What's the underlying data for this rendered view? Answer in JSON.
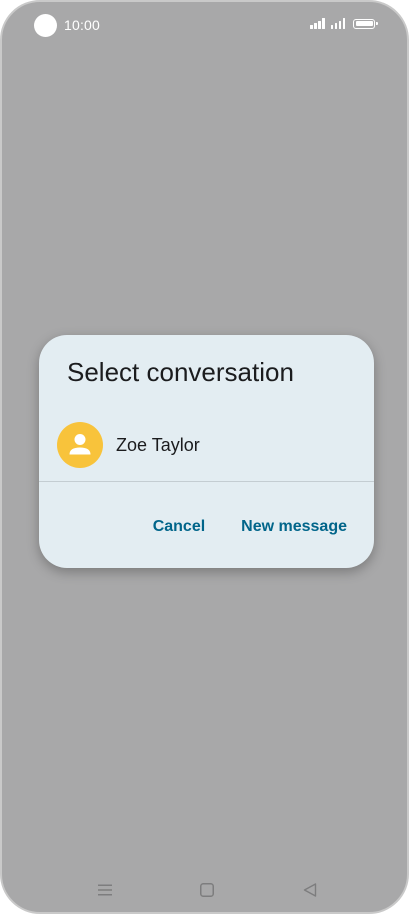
{
  "status_bar": {
    "time": "10:00",
    "icons": [
      "camera-cutout",
      "signal-icon",
      "signal-icon",
      "battery-icon"
    ]
  },
  "dialog": {
    "title": "Select conversation",
    "conversations": [
      {
        "name": "Zoe Taylor",
        "avatar_icon": "person-icon",
        "avatar_color": "#f8c33b"
      }
    ],
    "cancel_label": "Cancel",
    "new_message_label": "New message"
  },
  "navigation_bar": {
    "icons": [
      "menu-icon",
      "home-icon",
      "back-icon"
    ]
  },
  "colors": {
    "background": "#a8a8a9",
    "dialog_background": "#e3edf2",
    "accent": "#01658a",
    "avatar": "#f8c33b"
  }
}
